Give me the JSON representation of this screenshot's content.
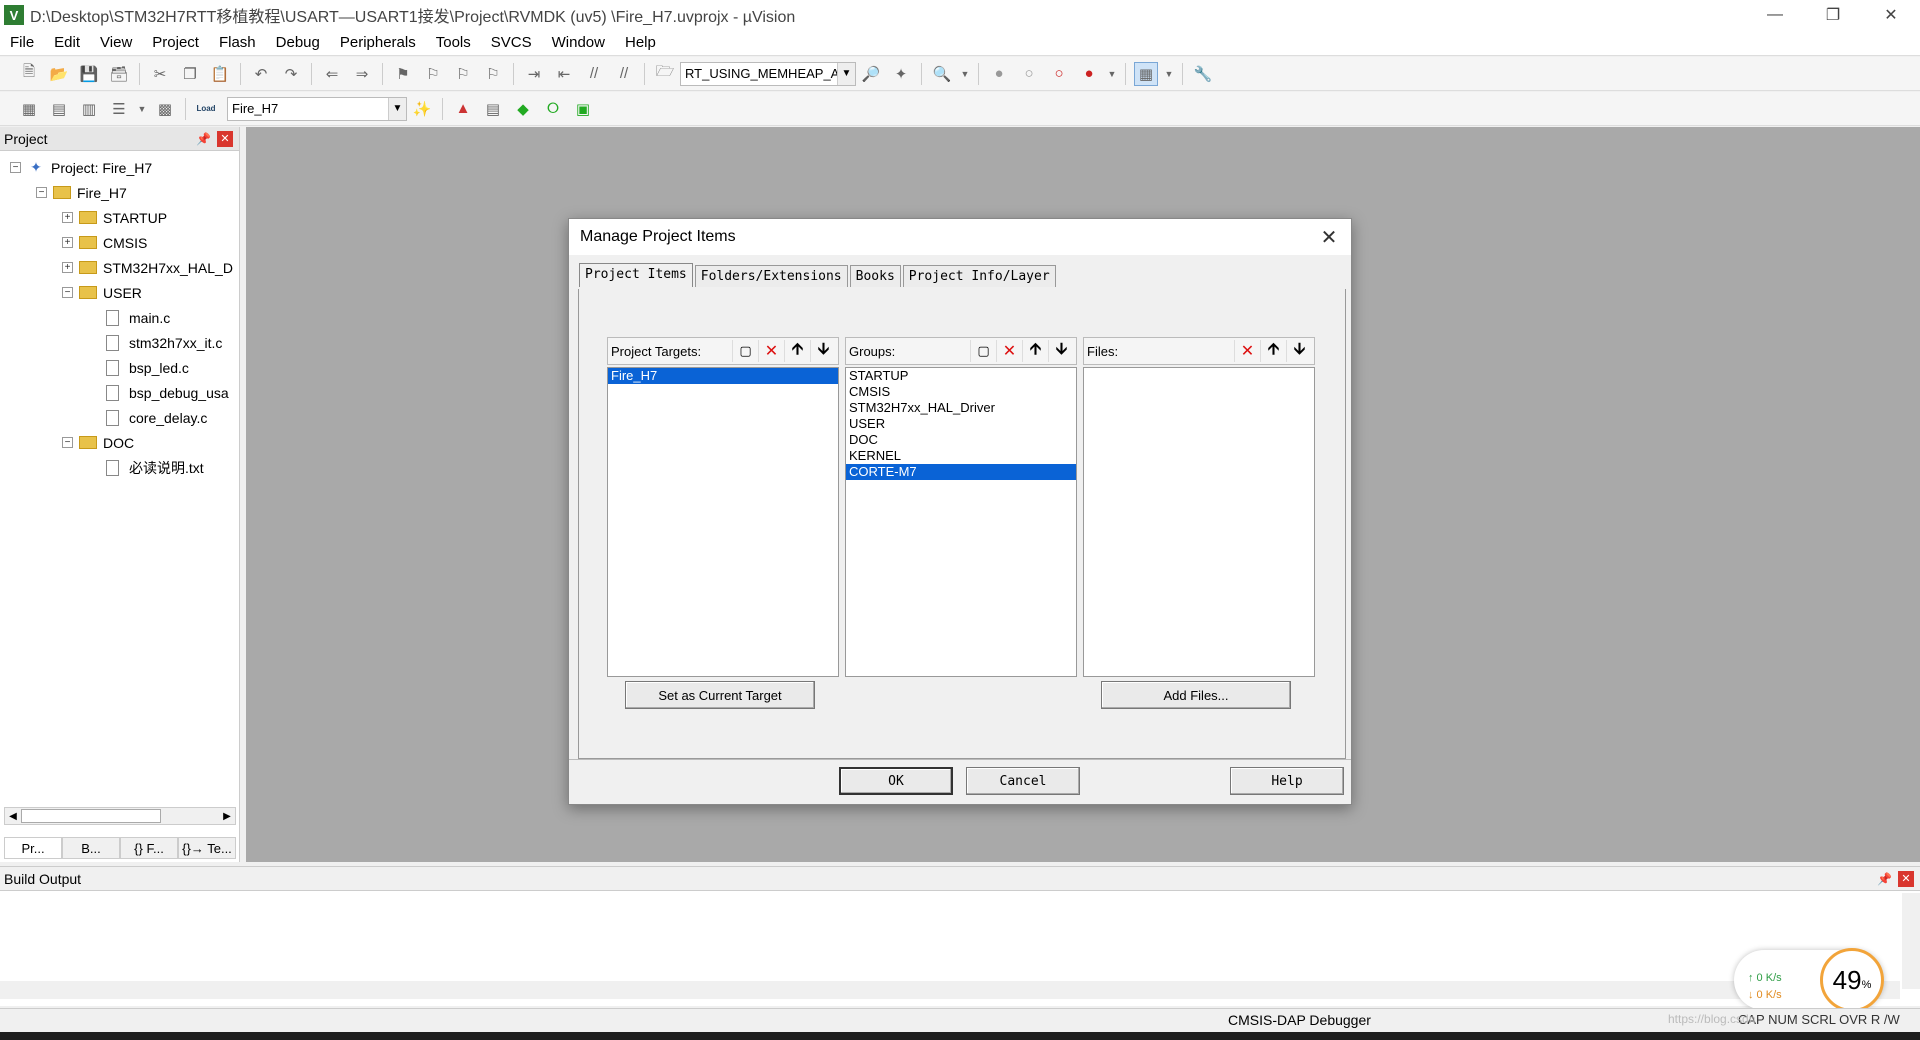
{
  "window": {
    "title": "D:\\Desktop\\STM32H7RTT移植教程\\USART—USART1接发\\Project\\RVMDK  (uv5)  \\Fire_H7.uvprojx - µVision",
    "app_icon": "V"
  },
  "menu": [
    "File",
    "Edit",
    "View",
    "Project",
    "Flash",
    "Debug",
    "Peripherals",
    "Tools",
    "SVCS",
    "Window",
    "Help"
  ],
  "toolbar": {
    "find_combo": "RT_USING_MEMHEAP_AS",
    "target_combo": "Fire_H7",
    "load_label": "Load"
  },
  "project_panel": {
    "title": "Project",
    "tree": [
      {
        "label": "Project: Fire_H7",
        "type": "project",
        "level": 0,
        "exp": "−"
      },
      {
        "label": "Fire_H7",
        "type": "group-root",
        "level": 1,
        "exp": "−"
      },
      {
        "label": "STARTUP",
        "type": "folder",
        "level": 2,
        "exp": "+"
      },
      {
        "label": "CMSIS",
        "type": "folder",
        "level": 2,
        "exp": "+"
      },
      {
        "label": "STM32H7xx_HAL_D",
        "type": "folder",
        "level": 2,
        "exp": "+"
      },
      {
        "label": "USER",
        "type": "folder",
        "level": 2,
        "exp": "−"
      },
      {
        "label": "main.c",
        "type": "file",
        "level": 3
      },
      {
        "label": "stm32h7xx_it.c",
        "type": "file",
        "level": 3
      },
      {
        "label": "bsp_led.c",
        "type": "file",
        "level": 3
      },
      {
        "label": "bsp_debug_usa",
        "type": "file",
        "level": 3
      },
      {
        "label": "core_delay.c",
        "type": "file",
        "level": 3
      },
      {
        "label": "DOC",
        "type": "folder",
        "level": 2,
        "exp": "−"
      },
      {
        "label": "必读说明.txt",
        "type": "file",
        "level": 3
      }
    ],
    "tabs": [
      "Pr...",
      "B...",
      "{} F...",
      "{}→ Te..."
    ]
  },
  "build_output": {
    "title": "Build Output"
  },
  "status": {
    "debugger": "CMSIS-DAP Debugger",
    "indicators": "CAP  NUM  SCRL OVR  R /W"
  },
  "net_widget": {
    "up": "↑ 0   K/s",
    "down": "↓ 0   K/s",
    "percent": "49",
    "percent_unit": "%"
  },
  "watermark": "https://blog.csdn",
  "dialog": {
    "title": "Manage Project Items",
    "tabs": [
      "Project Items",
      "Folders/Extensions",
      "Books",
      "Project Info/Layer"
    ],
    "targets": {
      "label": "Project Targets:",
      "items": [
        "Fire_H7"
      ],
      "selected": 0,
      "button": "Set as Current Target"
    },
    "groups": {
      "label": "Groups:",
      "items": [
        "STARTUP",
        "CMSIS",
        "STM32H7xx_HAL_Driver",
        "USER",
        "DOC",
        "KERNEL",
        "CORTE-M7"
      ],
      "selected": 6
    },
    "files": {
      "label": "Files:",
      "items": [],
      "button": "Add Files..."
    },
    "ok": "OK",
    "cancel": "Cancel",
    "help": "Help"
  }
}
